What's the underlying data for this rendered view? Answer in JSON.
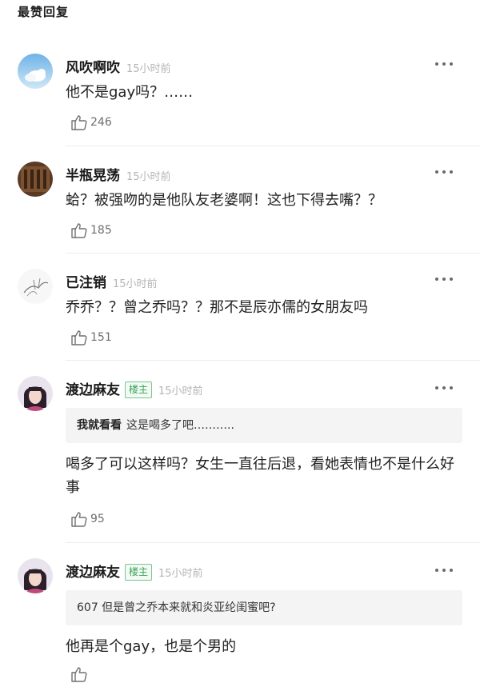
{
  "section_title": "最赞回复",
  "comments": [
    {
      "username": "风吹啊吹",
      "time": "15小时前",
      "badge": "",
      "text": "他不是gay吗？……",
      "likes": "246"
    },
    {
      "username": "半瓶晃荡",
      "time": "15小时前",
      "badge": "",
      "text": "蛤？被强吻的是他队友老婆啊！这也下得去嘴？？",
      "likes": "185"
    },
    {
      "username": "已注销",
      "time": "15小时前",
      "badge": "",
      "text": "乔乔？？曾之乔吗？？那不是辰亦儒的女朋友吗",
      "likes": "151"
    },
    {
      "username": "渡边麻友",
      "time": "15小时前",
      "badge": "楼主",
      "quote_user": "我就看看",
      "quote_text": "这是喝多了吧………..",
      "text": "喝多了可以这样吗？女生一直往后退，看她表情也不是什么好事",
      "likes": "95"
    },
    {
      "username": "渡边麻友",
      "time": "15小时前",
      "badge": "楼主",
      "quote_user": "",
      "quote_text": "607 但是曾之乔本来就和炎亚纶闺蜜吧?",
      "text": "他再是个gay，也是个男的",
      "likes": ""
    }
  ],
  "colors": {
    "badge_green": "#3aa05a",
    "muted_gray": "#b5b5b5",
    "quote_bg": "#f4f4f4"
  },
  "icons": {
    "like": "thumbs-up-icon",
    "more": "more-dots-icon"
  }
}
